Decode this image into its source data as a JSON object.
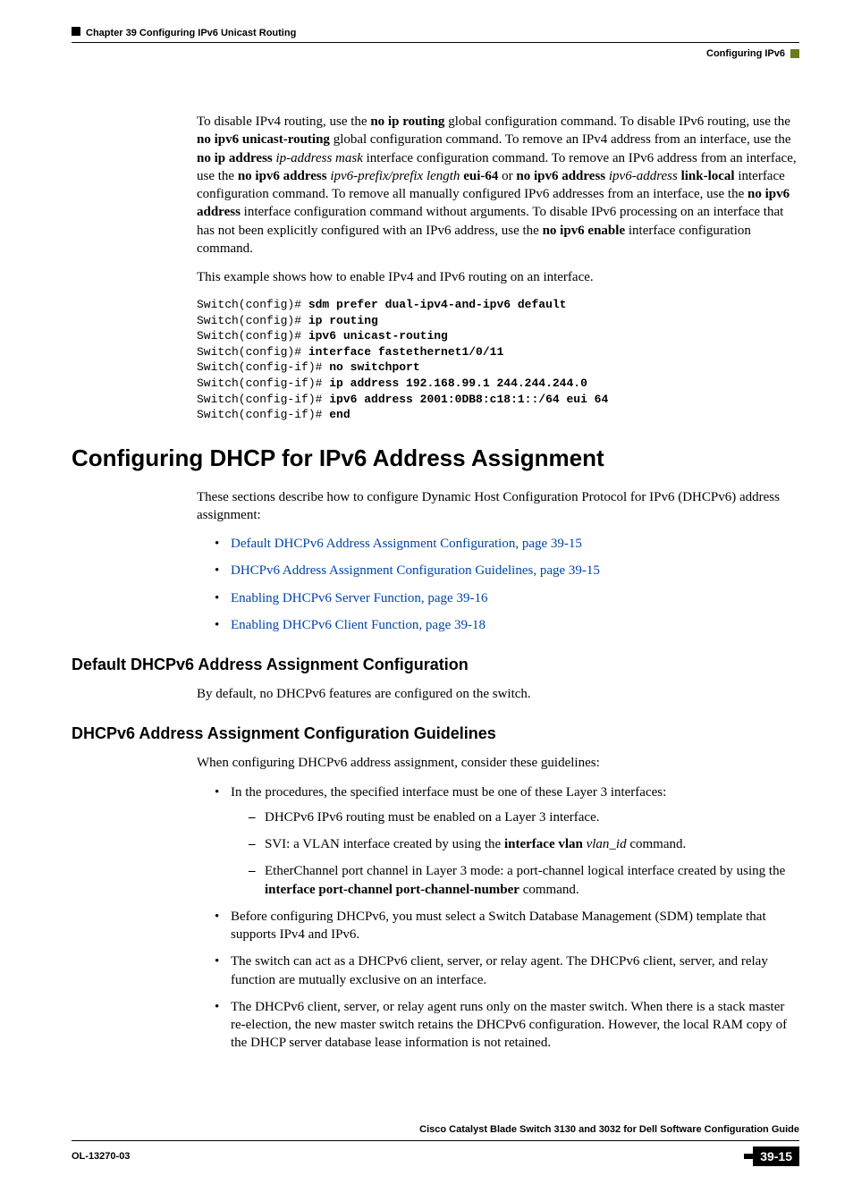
{
  "header": {
    "chapter": "Chapter 39    Configuring IPv6 Unicast Routing",
    "section": "Configuring IPv6"
  },
  "intro": {
    "para1_parts": [
      {
        "t": "To disable IPv4 routing, use the "
      },
      {
        "t": "no ip routing",
        "b": true
      },
      {
        "t": " global configuration command. To disable IPv6 routing, use the "
      },
      {
        "t": "no ipv6 unicast-routing",
        "b": true
      },
      {
        "t": " global configuration command. To remove an IPv4 address from an interface, use the "
      },
      {
        "t": "no ip address",
        "b": true
      },
      {
        "t": " "
      },
      {
        "t": "ip-address mask",
        "i": true
      },
      {
        "t": " interface configuration command. To remove an IPv6 address from an interface, use the "
      },
      {
        "t": "no ipv6 address",
        "b": true
      },
      {
        "t": " "
      },
      {
        "t": "ipv6-prefix/prefix length",
        "i": true
      },
      {
        "t": " "
      },
      {
        "t": "eui-64",
        "b": true
      },
      {
        "t": " or "
      },
      {
        "t": "no ipv6 address",
        "b": true
      },
      {
        "t": " "
      },
      {
        "t": "ipv6-address",
        "i": true
      },
      {
        "t": " "
      },
      {
        "t": "link-local",
        "b": true
      },
      {
        "t": " interface configuration command. To remove all manually configured IPv6 addresses from an interface, use the "
      },
      {
        "t": "no ipv6 address",
        "b": true
      },
      {
        "t": " interface configuration command without arguments. To disable IPv6 processing on an interface that has not been explicitly configured with an IPv6 address, use the "
      },
      {
        "t": "no ipv6 enable",
        "b": true
      },
      {
        "t": " interface configuration command."
      }
    ],
    "para2": "This example shows how to enable IPv4 and IPv6 routing on an interface."
  },
  "code": [
    {
      "p": "Switch(config)# ",
      "c": "sdm prefer dual-ipv4-and-ipv6 default"
    },
    {
      "p": "Switch(config)# ",
      "c": "ip routing"
    },
    {
      "p": "Switch(config)# ",
      "c": "ipv6 unicast-routing"
    },
    {
      "p": "Switch(config)# ",
      "c": "interface fastethernet1/0/11"
    },
    {
      "p": "Switch(config-if)# ",
      "c": "no switchport"
    },
    {
      "p": "Switch(config-if)# ",
      "c": "ip address 192.168.99.1 244.244.244.0"
    },
    {
      "p": "Switch(config-if)# ",
      "c": "ipv6 address 2001:0DB8:c18:1::/64 eui 64"
    },
    {
      "p": "Switch(config-if)# ",
      "c": "end"
    }
  ],
  "section1": {
    "title": "Configuring DHCP for IPv6 Address Assignment",
    "intro": "These sections describe how to configure Dynamic Host Configuration Protocol for IPv6 (DHCPv6) address assignment:",
    "links": [
      "Default DHCPv6 Address Assignment Configuration, page 39-15",
      "DHCPv6 Address Assignment Configuration Guidelines, page 39-15",
      "Enabling DHCPv6 Server Function, page 39-16",
      "Enabling DHCPv6 Client Function, page 39-18"
    ]
  },
  "sub1": {
    "title": "Default DHCPv6 Address Assignment Configuration",
    "para": "By default, no DHCPv6 features are configured on the switch."
  },
  "sub2": {
    "title": "DHCPv6 Address Assignment Configuration Guidelines",
    "intro": "When configuring DHCPv6 address assignment, consider these guidelines:",
    "bullets": {
      "b1": "In the procedures, the specified interface must be one of these Layer 3 interfaces:",
      "b1_sub": [
        {
          "parts": [
            {
              "t": "DHCPv6 IPv6 routing must be enabled on a Layer 3 interface."
            }
          ]
        },
        {
          "parts": [
            {
              "t": "SVI: a VLAN interface created by using the "
            },
            {
              "t": "interface vlan",
              "b": true
            },
            {
              "t": " "
            },
            {
              "t": "vlan_id",
              "i": true
            },
            {
              "t": " command."
            }
          ]
        },
        {
          "parts": [
            {
              "t": "EtherChannel port channel in Layer 3 mode: a port-channel logical interface created by using the "
            },
            {
              "t": "interface port-channel port-channel-number",
              "b": true
            },
            {
              "t": " command."
            }
          ]
        }
      ],
      "b2": "Before configuring DHCPv6, you must select a Switch Database Management (SDM) template that supports IPv4 and IPv6.",
      "b3": "The switch can act as a DHCPv6 client, server, or relay agent. The DHCPv6 client, server, and relay function are mutually exclusive on an interface.",
      "b4": "The DHCPv6 client, server, or relay agent runs only on the master switch. When there is a stack master re-election, the new master switch retains the DHCPv6 configuration. However, the local RAM copy of the DHCP server database lease information is not retained."
    }
  },
  "footer": {
    "guide": "Cisco Catalyst Blade Switch 3130 and 3032 for Dell Software Configuration Guide",
    "docnum": "OL-13270-03",
    "pagenum": "39-15"
  }
}
